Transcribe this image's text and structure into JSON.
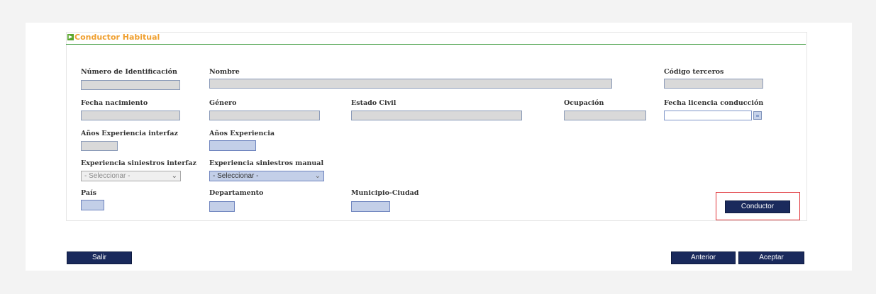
{
  "section": {
    "title": "Conductor Habitual"
  },
  "fields": {
    "numero_identificacion": {
      "label": "Número de Identificación",
      "value": ""
    },
    "nombre": {
      "label": "Nombre",
      "value": ""
    },
    "codigo_terceros": {
      "label": "Código terceros",
      "value": ""
    },
    "fecha_nacimiento": {
      "label": "Fecha nacimiento",
      "value": ""
    },
    "genero": {
      "label": "Género",
      "value": ""
    },
    "estado_civil": {
      "label": "Estado Civil",
      "value": ""
    },
    "ocupacion": {
      "label": "Ocupación",
      "value": ""
    },
    "fecha_licencia": {
      "label": "Fecha licencia conducción",
      "value": ""
    },
    "anios_exp_interfaz": {
      "label": "Años Experiencia interfaz",
      "value": ""
    },
    "anios_exp": {
      "label": "Años Experiencia",
      "value": ""
    },
    "exp_siniestros_interfaz": {
      "label": "Experiencia siniestros interfaz",
      "selected": "- Seleccionar -"
    },
    "exp_siniestros_manual": {
      "label": "Experiencia siniestros manual",
      "selected": "- Seleccionar -"
    },
    "pais": {
      "label": "País",
      "value": ""
    },
    "departamento": {
      "label": "Departamento",
      "value": ""
    },
    "municipio": {
      "label": "Municipio-Ciudad",
      "value": ""
    }
  },
  "buttons": {
    "conductor": "Conductor",
    "salir": "Salir",
    "anterior": "Anterior",
    "aceptar": "Aceptar"
  },
  "colors": {
    "accent_title": "#f0a030",
    "header_rule": "#3d9a3d",
    "button_bg": "#1a2a5c",
    "highlight": "#e0353a"
  }
}
